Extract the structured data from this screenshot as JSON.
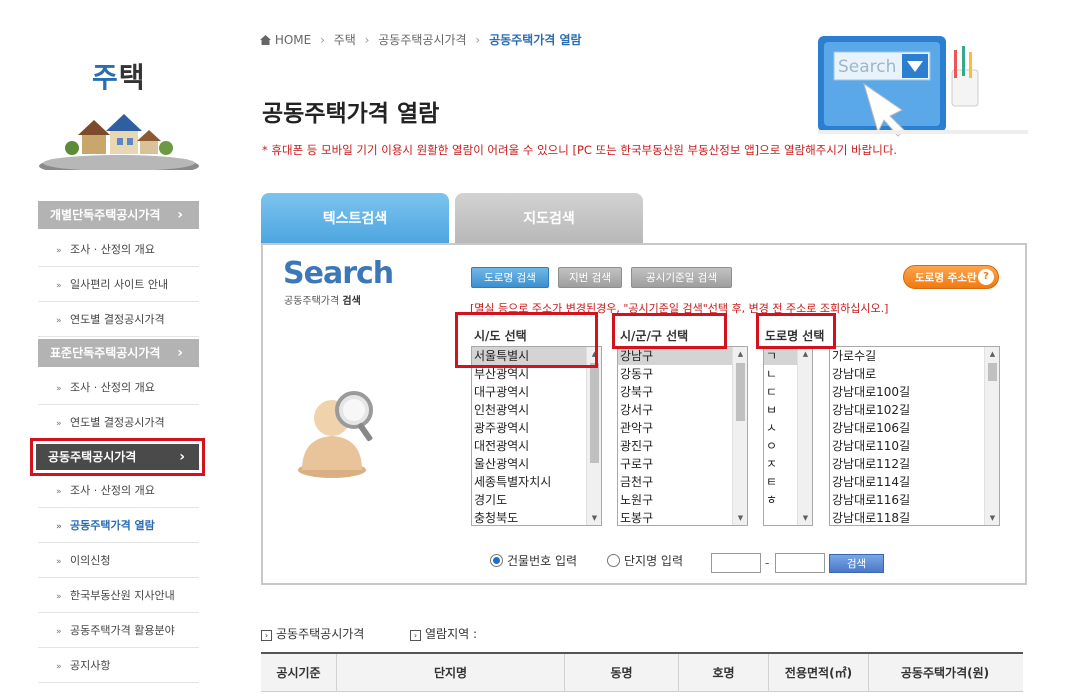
{
  "sidebar": {
    "title_a": "주",
    "title_b": "택",
    "cat1": "개별단독주택공시가격",
    "cat1_items": [
      "조사 · 산정의 개요",
      "일사편리 사이트 안내",
      "연도별 결정공시가격"
    ],
    "cat2": "표준단독주택공시가격",
    "cat2_items": [
      "조사 · 산정의 개요",
      "연도별 결정공시가격"
    ],
    "cat3": "공동주택공시가격",
    "cat3_items": [
      "조사 · 산정의 개요",
      "공동주택가격 열람",
      "이의신청",
      "한국부동산원 지사안내",
      "공동주택가격 활용분야",
      "공지사항"
    ],
    "chevron": "›",
    "bullet": "»"
  },
  "breadcrumb": {
    "home": "HOME",
    "l1": "주택",
    "l2": "공동주택공시가격",
    "l3": "공동주택가격 열람",
    "sep": "›"
  },
  "page": {
    "title": "공동주택가격 열람",
    "notice": "* 휴대폰 등 모바일 기기 이용시 원활한 열람이 어려울 수 있으니 [PC 또는 한국부동산원 부동산정보 앱]으로 열람해주시기 바랍니다."
  },
  "hero": {
    "search_text": "Search"
  },
  "tabs": {
    "text_search": "텍스트검색",
    "map_search": "지도검색"
  },
  "search": {
    "logo": "Search",
    "logo_sub_a": "공동주택가격",
    "logo_sub_b": "검색",
    "btn_road": "도로명 검색",
    "btn_lot": "지번 검색",
    "btn_date": "공시기준일 검색",
    "btn_road_addr": "도로명 주소란",
    "btn_road_addr_q": "?",
    "warn": "[멸실 등으로 주소가 변경된경우, \"공시기준일 검색\"선택 후, 변경 전 주소로 조회하십시오.]",
    "col_sido": "시/도 선택",
    "col_sigungu": "시/군/구 선택",
    "col_road": "도로명 선택",
    "sido": [
      "서울특별시",
      "부산광역시",
      "대구광역시",
      "인천광역시",
      "광주광역시",
      "대전광역시",
      "울산광역시",
      "세종특별자치시",
      "경기도",
      "충청북도"
    ],
    "sigungu": [
      "강남구",
      "강동구",
      "강북구",
      "강서구",
      "관악구",
      "광진구",
      "구로구",
      "금천구",
      "노원구",
      "도봉구"
    ],
    "initials": [
      "ㄱ",
      "ㄴ",
      "ㄷ",
      "ㅂ",
      "ㅅ",
      "ㅇ",
      "ㅈ",
      "ㅌ",
      "ㅎ"
    ],
    "roads": [
      "가로수길",
      "강남대로",
      "강남대로100길",
      "강남대로102길",
      "강남대로106길",
      "강남대로110길",
      "강남대로112길",
      "강남대로114길",
      "강남대로116길",
      "강남대로118길"
    ],
    "radio_building": "건물번호 입력",
    "radio_complex": "단지명 입력",
    "dash": "-",
    "btn_submit": "검색",
    "scroll_up": "▲",
    "scroll_down": "▼"
  },
  "results": {
    "label1": "공동주택공시가격",
    "label2": "열람지역 :",
    "icon": "›",
    "headers": [
      "공시기준",
      "단지명",
      "동명",
      "호명",
      "전용면적(㎡)",
      "공동주택가격(원)"
    ]
  }
}
